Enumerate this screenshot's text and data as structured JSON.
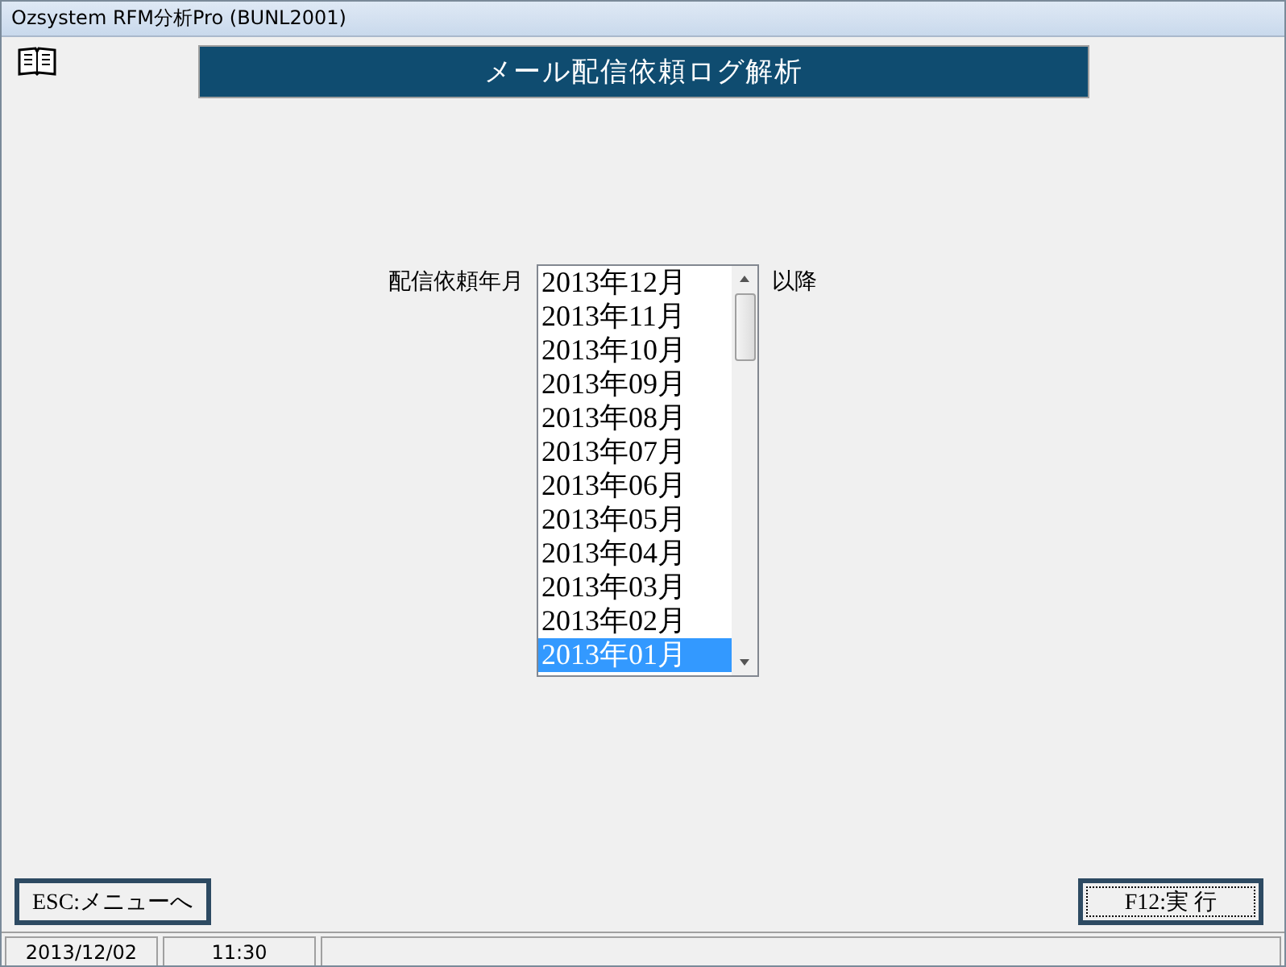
{
  "window": {
    "title": "Ozsystem RFM分析Pro (BUNL2001)"
  },
  "header": {
    "title": "メール配信依頼ログ解析"
  },
  "form": {
    "label": "配信依頼年月",
    "suffix": "以降",
    "options": [
      {
        "label": "2013年12月",
        "selected": false
      },
      {
        "label": "2013年11月",
        "selected": false
      },
      {
        "label": "2013年10月",
        "selected": false
      },
      {
        "label": "2013年09月",
        "selected": false
      },
      {
        "label": "2013年08月",
        "selected": false
      },
      {
        "label": "2013年07月",
        "selected": false
      },
      {
        "label": "2013年06月",
        "selected": false
      },
      {
        "label": "2013年05月",
        "selected": false
      },
      {
        "label": "2013年04月",
        "selected": false
      },
      {
        "label": "2013年03月",
        "selected": false
      },
      {
        "label": "2013年02月",
        "selected": false
      },
      {
        "label": "2013年01月",
        "selected": true
      }
    ]
  },
  "buttons": [
    {
      "label": "ESC:メニューへ",
      "focused": false
    },
    {
      "label": "F12:実 行",
      "focused": true
    }
  ],
  "status_bar": [
    "2013/12/02",
    "11:30"
  ]
}
